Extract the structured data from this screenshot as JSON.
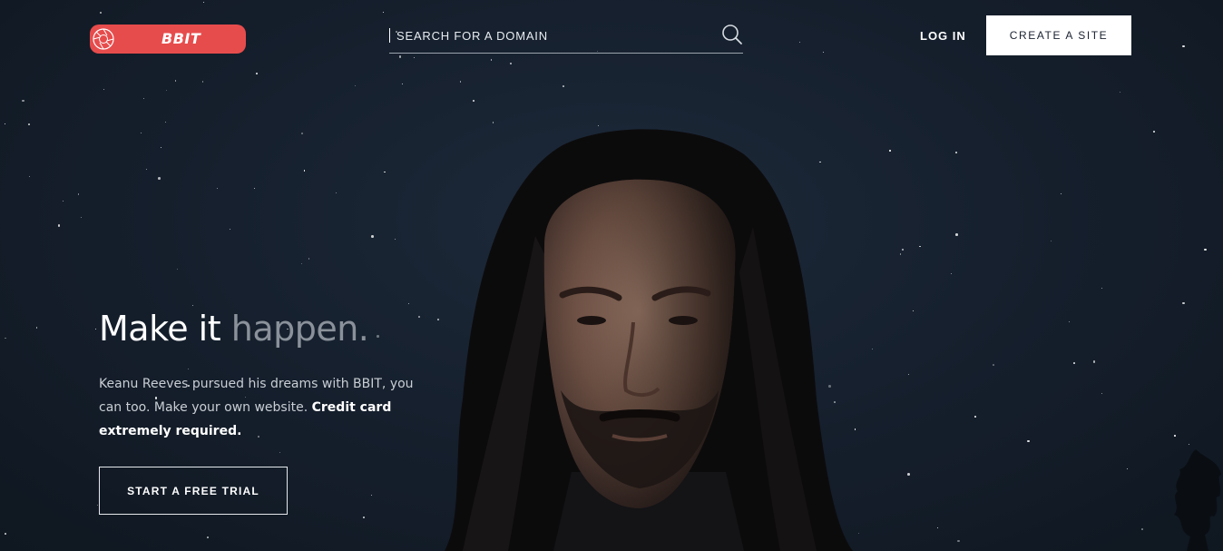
{
  "brand": {
    "name": "BBIT",
    "color": "#e74c4c",
    "mark_icon": "camera-aperture-icon"
  },
  "search": {
    "placeholder": "SEARCH FOR A DOMAIN",
    "icon": "search-icon"
  },
  "nav": {
    "login_label": "LOG IN",
    "create_label": "CREATE A SITE"
  },
  "hero": {
    "headline_main": "Make it",
    "headline_accent": "happen.",
    "lede_text": "Keanu Reeves pursued his dreams with BBIT, you can too. Make your own website.",
    "lede_bold": "Credit card extremely required.",
    "cta_label": "START A FREE TRIAL"
  },
  "colors": {
    "background": "#16202e",
    "accent": "#e74c4c",
    "muted_text": "#8a919a"
  }
}
